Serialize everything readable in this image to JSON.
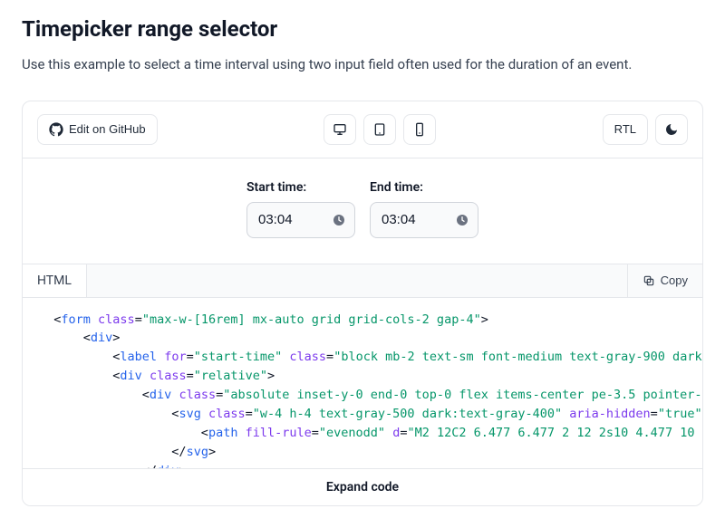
{
  "heading": "Timepicker range selector",
  "description": "Use this example to select a time interval using two input field often used for the duration of an event.",
  "toolbar": {
    "edit_on_github": "Edit on GitHub",
    "rtl_label": "RTL"
  },
  "form": {
    "start_label": "Start time:",
    "end_label": "End time:",
    "start_value": "03:04",
    "end_value": "03:04"
  },
  "code_tabs": {
    "html_tab": "HTML",
    "copy_label": "Copy"
  },
  "expand_label": "Expand code"
}
